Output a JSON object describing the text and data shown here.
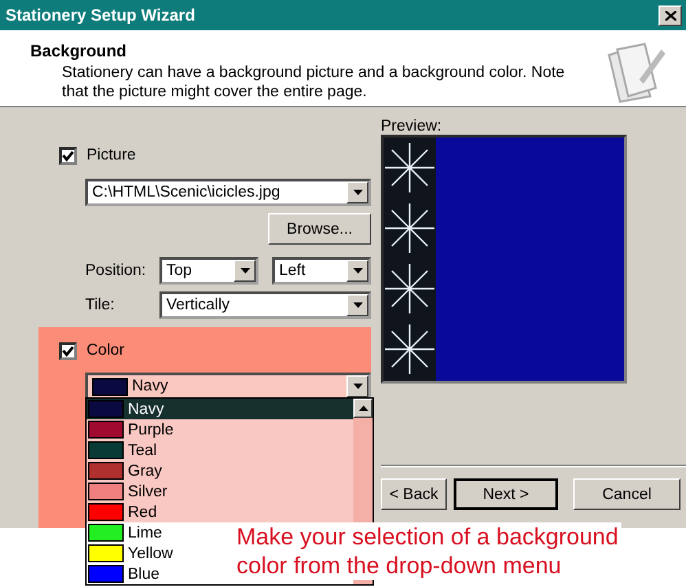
{
  "window": {
    "title": "Stationery Setup Wizard"
  },
  "header": {
    "title": "Background",
    "description": "Stationery can have a background picture and a background color. Note that the picture might cover the entire page."
  },
  "picture": {
    "label": "Picture",
    "checked": true,
    "path": "C:\\HTML\\Scenic\\icicles.jpg",
    "browse_button": "Browse...",
    "position_label": "Position:",
    "position_vertical": "Top",
    "position_horizontal": "Left",
    "tile_label": "Tile:",
    "tile": "Vertically"
  },
  "color": {
    "label": "Color",
    "checked": true,
    "value": "Navy",
    "options": [
      {
        "name": "Navy",
        "color": "#0a0a40",
        "selected": true
      },
      {
        "name": "Purple",
        "color": "#a00a30",
        "selected": false
      },
      {
        "name": "Teal",
        "color": "#0a3a35",
        "selected": false
      },
      {
        "name": "Gray",
        "color": "#b03030",
        "selected": false
      },
      {
        "name": "Silver",
        "color": "#f08080",
        "selected": false
      },
      {
        "name": "Red",
        "color": "#ff0000",
        "selected": false
      },
      {
        "name": "Lime",
        "color": "#22ee22",
        "selected": false
      },
      {
        "name": "Yellow",
        "color": "#ffff00",
        "selected": false
      },
      {
        "name": "Blue",
        "color": "#0000ff",
        "selected": false
      }
    ]
  },
  "preview": {
    "label": "Preview:"
  },
  "buttons": [
    {
      "label": "< Back",
      "default": false
    },
    {
      "label": "Next >",
      "default": true
    },
    {
      "label": "Cancel",
      "default": false
    }
  ],
  "caption_lines": [
    "Make your selection of a background",
    "color from the drop-down menu"
  ]
}
